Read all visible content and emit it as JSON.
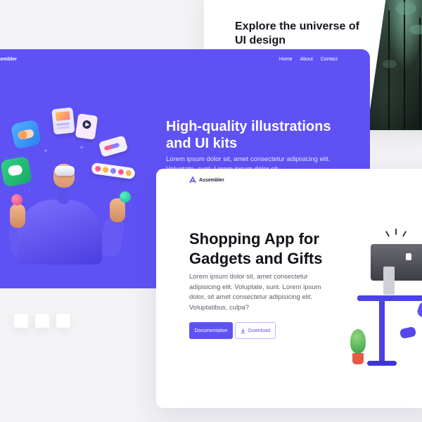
{
  "explore": {
    "title": "Explore the universe of UI design"
  },
  "purple_card": {
    "logo": "sembler",
    "nav": [
      "Home",
      "About",
      "Contact"
    ],
    "title": "High-quality illustrations and UI kits",
    "description": "Lorem ipsum dolor sit, amet consectetur adipisicing elit. Voluptate, sunt. Lorem ipsum dolor sit"
  },
  "white_card": {
    "logo": "Assembler",
    "title": "Shopping App for Gadgets and Gifts",
    "description": "Lorem ipsum dolor sit, amet consectetur adipisicing elit. Voluptate, sunt. Lorem ipsum dolor, sit amet consectetur adipisicing elit. Voluptatibus, culpa?",
    "buttons": {
      "documentation": "Documentation",
      "download": "Download"
    }
  },
  "colors": {
    "accent": "#5f52f5",
    "background": "#f3f3f6"
  },
  "icons": {
    "logo": "assembler-logo-icon",
    "download": "download-icon"
  }
}
